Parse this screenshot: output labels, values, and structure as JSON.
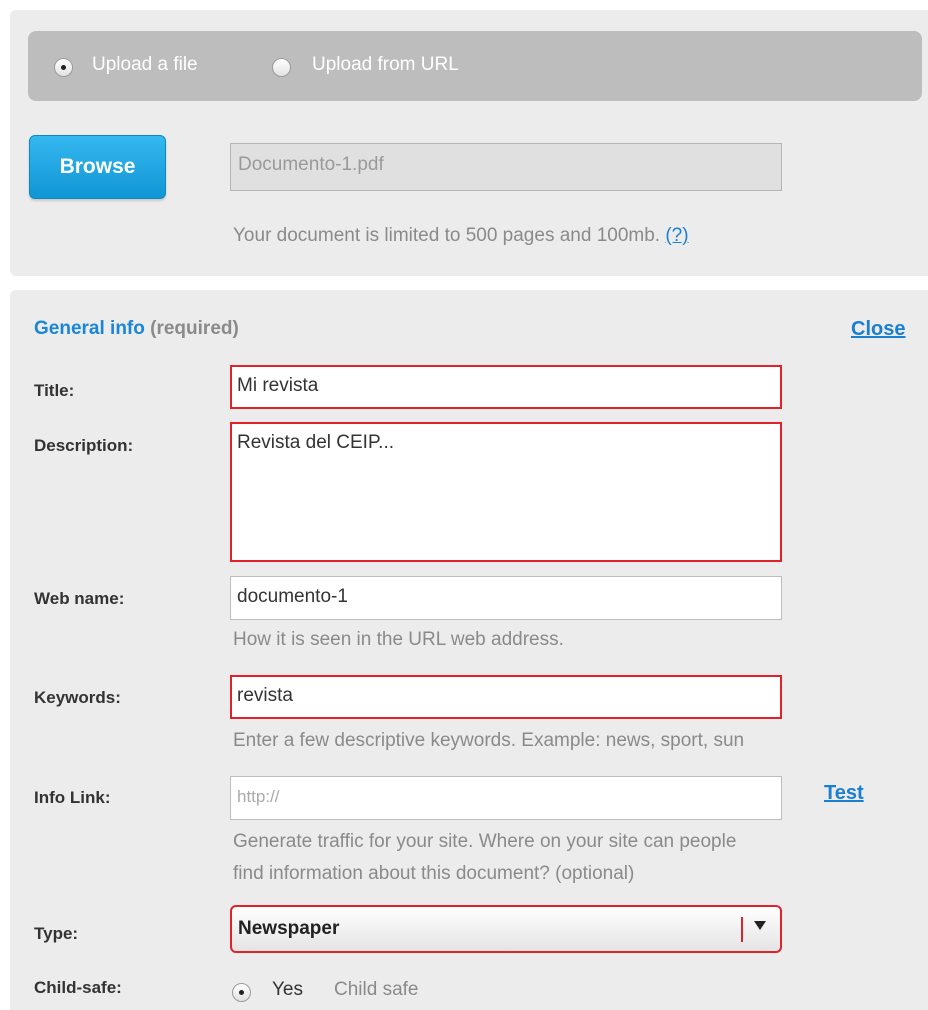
{
  "upload": {
    "option_file": "Upload a file",
    "option_url": "Upload from URL",
    "selected": "file",
    "browse_label": "Browse",
    "file_name": "Documento-1.pdf",
    "limit_note": "Your document is limited to 500 pages and 100mb.",
    "help_link": "(?)"
  },
  "general_info": {
    "heading": "General info",
    "required_note": "(required)",
    "close_label": "Close",
    "fields": {
      "title": {
        "label": "Title:",
        "value": "Mi revista"
      },
      "description": {
        "label": "Description:",
        "value": "Revista del CEIP..."
      },
      "web_name": {
        "label": "Web name:",
        "value": "documento-1",
        "hint": "How it is seen in the URL web address."
      },
      "keywords": {
        "label": "Keywords:",
        "value": "revista",
        "hint": "Enter a few descriptive keywords. Example: news, sport, sun"
      },
      "info_link": {
        "label": "Info Link:",
        "placeholder": "http://",
        "test_label": "Test",
        "hint_line1": "Generate traffic for your site. Where on your site can people",
        "hint_line2": "find information about this document? (optional)"
      },
      "type": {
        "label": "Type:",
        "selected": "Newspaper"
      },
      "child_safe": {
        "label": "Child-safe:",
        "option_yes": "Yes",
        "option_yes_note": "Child safe"
      }
    }
  },
  "colors": {
    "accent_blue": "#1a86d6",
    "error_red": "#e0222a",
    "panel_gray": "#ececec"
  }
}
